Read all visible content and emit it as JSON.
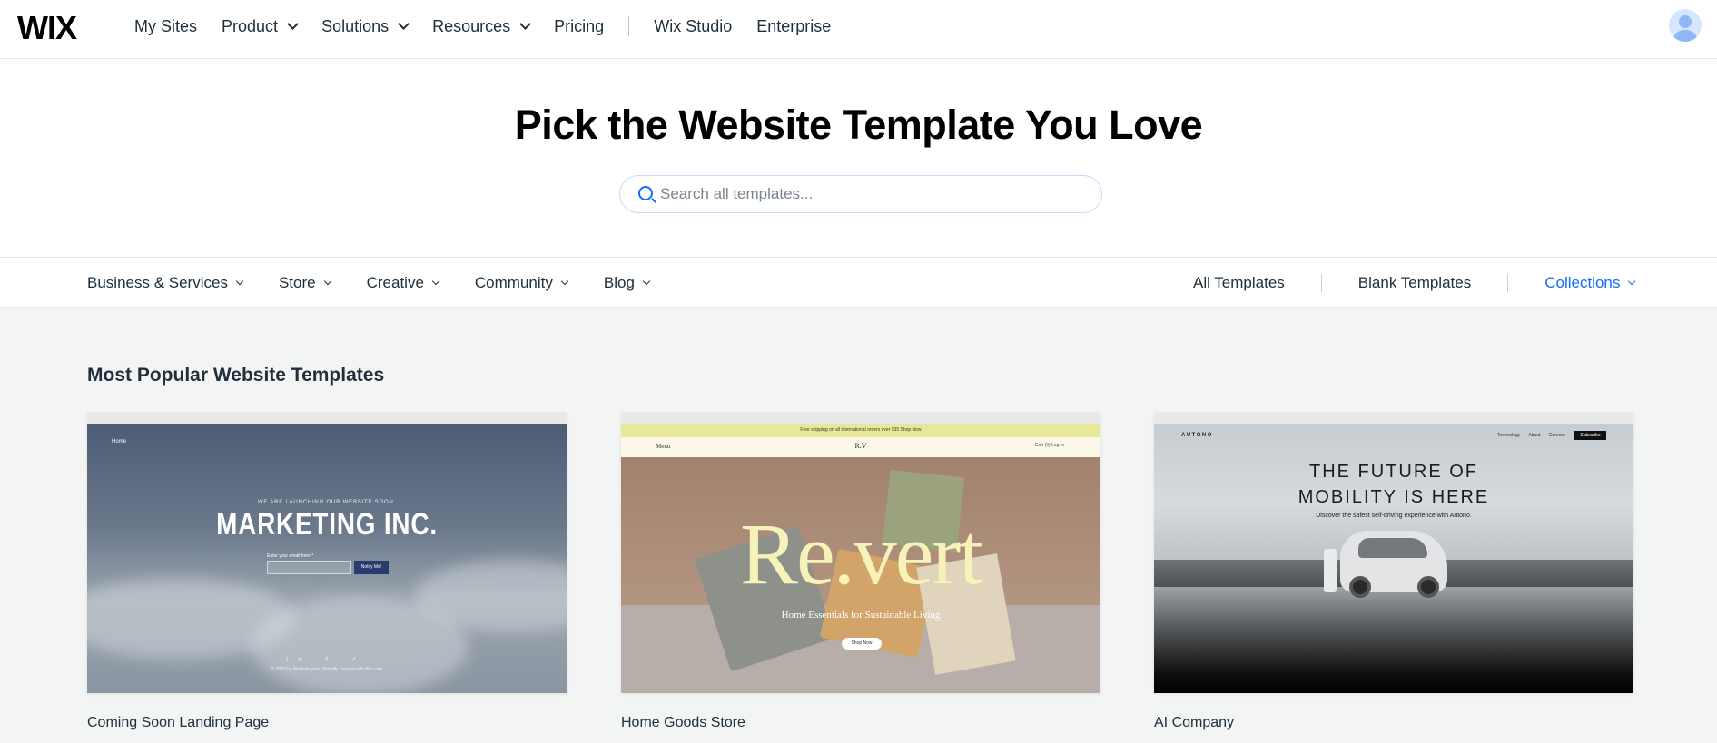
{
  "topnav": {
    "logo": "WIX",
    "links": [
      {
        "label": "My Sites",
        "dropdown": false
      },
      {
        "label": "Product",
        "dropdown": true
      },
      {
        "label": "Solutions",
        "dropdown": true
      },
      {
        "label": "Resources",
        "dropdown": true
      },
      {
        "label": "Pricing",
        "dropdown": false
      }
    ],
    "links_after_sep": [
      {
        "label": "Wix Studio"
      },
      {
        "label": "Enterprise"
      }
    ]
  },
  "hero": {
    "title": "Pick the Website Template You Love",
    "search_placeholder": "Search all templates..."
  },
  "categories": {
    "left": [
      "Business & Services",
      "Store",
      "Creative",
      "Community",
      "Blog"
    ],
    "all_templates": "All Templates",
    "blank_templates": "Blank Templates",
    "collections": "Collections"
  },
  "gallery": {
    "section_title": "Most Popular Website Templates",
    "cards": [
      {
        "name": "Coming Soon Landing Page",
        "preview": {
          "nav": "Home",
          "subtitle": "WE ARE LAUNCHING OUR WEBSITE SOON.",
          "headline": "MARKETING INC.",
          "email_label": "Enter your email here *",
          "button": "Notify Me!",
          "social": "in f ✓",
          "copyright": "© 2023 by Marketing Inc. Proudly created with Wix.com"
        }
      },
      {
        "name": "Home Goods Store",
        "preview": {
          "strip": "Free shipping on all international orders over $35 Shop Now",
          "menu": "Menu",
          "center": "R.V",
          "right": "Cart (0)   Log In",
          "brand": "Re.vert",
          "tagline": "Home Essentials for Sustainable Living",
          "button": "Shop Now"
        }
      },
      {
        "name": "AI Company",
        "preview": {
          "logo": "AUTONO",
          "menu": "Technology About Careers",
          "subscribe": "Subscribe",
          "headline_1": "THE FUTURE OF",
          "headline_2": "MOBILITY IS HERE",
          "paragraph": "Discover the safest self-driving experience with Autono."
        }
      }
    ]
  },
  "colors": {
    "accent": "#116dff",
    "text": "#20303c",
    "gallery_bg": "#f3f5f4"
  }
}
